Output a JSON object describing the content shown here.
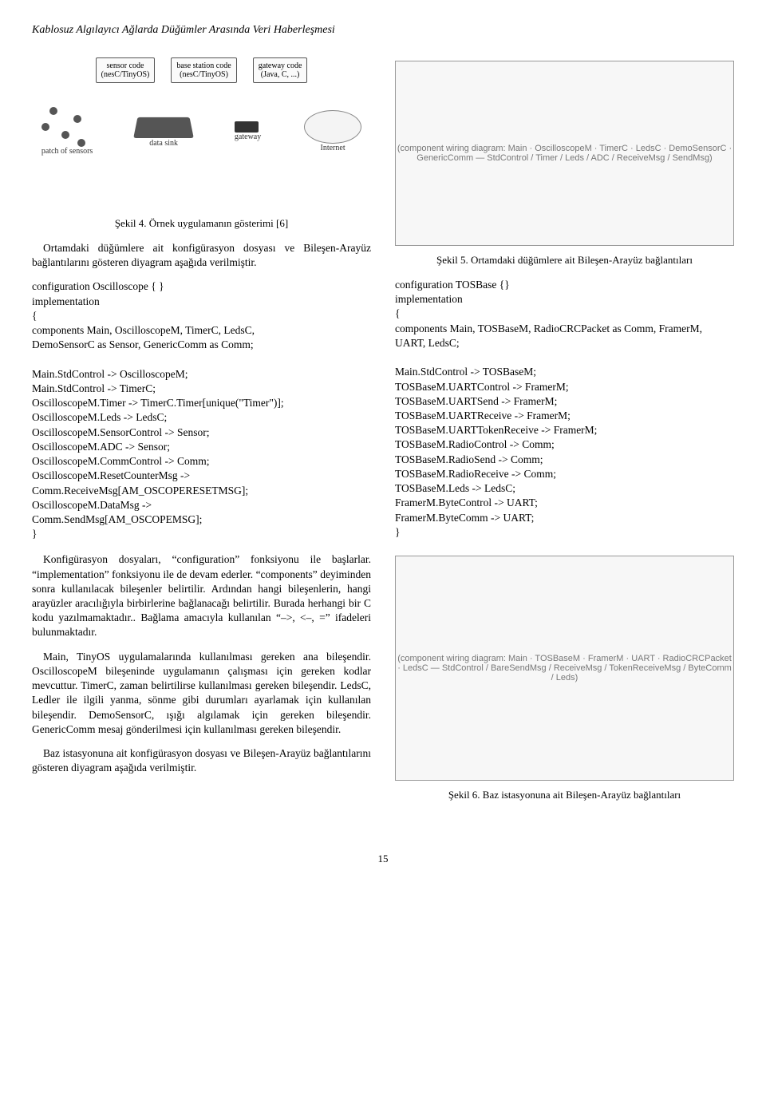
{
  "header": "Kablosuz Algılayıcı Ağlarda Düğümler Arasında Veri Haberleşmesi",
  "page_number": "15",
  "fig4": {
    "caption": "Şekil 4. Örnek uygulamanın gösterimi [6]",
    "box1": "sensor code\n(nesC/TinyOS)",
    "box2": "base station code\n(nesC/TinyOS)",
    "box3": "gateway code\n(Java, C, ...)",
    "lbl1": "patch of sensors",
    "lbl2": "data sink",
    "lbl3": "gateway",
    "lbl4": "Internet"
  },
  "fig5": {
    "caption": "Şekil 5. Ortamdaki düğümlere ait Bileşen-Arayüz bağlantıları",
    "placeholder": "(component wiring diagram: Main · OscilloscopeM · TimerC · LedsC · DemoSensorC · GenericComm — StdControl / Timer / Leds / ADC / ReceiveMsg / SendMsg)"
  },
  "fig6": {
    "caption": "Şekil 6. Baz istasyonuna ait Bileşen-Arayüz bağlantıları",
    "placeholder": "(component wiring diagram: Main · TOSBaseM · FramerM · UART · RadioCRCPacket · LedsC — StdControl / BareSendMsg / ReceiveMsg / TokenReceiveMsg / ByteComm / Leds)"
  },
  "left": {
    "para1": "Ortamdaki düğümlere ait konfigürasyon dosyası ve Bileşen-Arayüz bağlantılarını gösteren diyagram aşağıda verilmiştir.",
    "code1": "configuration Oscilloscope { }\nimplementation\n{\ncomponents Main, OscilloscopeM, TimerC, LedsC,\nDemoSensorC as Sensor, GenericComm as Comm;\n\nMain.StdControl -> OscilloscopeM;\nMain.StdControl -> TimerC;\nOscilloscopeM.Timer -> TimerC.Timer[unique(\"Timer\")];\nOscilloscopeM.Leds -> LedsC;\nOscilloscopeM.SensorControl -> Sensor;\nOscilloscopeM.ADC -> Sensor;\nOscilloscopeM.CommControl -> Comm;\nOscilloscopeM.ResetCounterMsg ->\nComm.ReceiveMsg[AM_OSCOPERESETMSG];\nOscilloscopeM.DataMsg ->\nComm.SendMsg[AM_OSCOPEMSG];\n}",
    "para2": "Konfigürasyon dosyaları, “configuration” fonksiyonu ile başlarlar. “implementation” fonksiyonu ile de devam ederler. “components” deyiminden sonra kullanılacak bileşenler belirtilir. Ardından hangi bileşenlerin, hangi arayüzler aracılığıyla birbirlerine bağlanacağı belirtilir. Burada herhangi bir C kodu yazılmamaktadır.. Bağlama amacıyla kullanılan “–>, <–, =” ifadeleri bulunmaktadır.",
    "para3": "Main, TinyOS uygulamalarında kullanılması gereken ana bileşendir. OscilloscopeM bileşeninde uygulamanın çalışması için gereken kodlar mevcuttur. TimerC, zaman belirtilirse kullanılması gereken bileşendir. LedsC, Ledler ile ilgili yanma, sönme gibi durumları ayarlamak için kullanılan bileşendir. DemoSensorC, ışığı algılamak için gereken bileşendir. GenericComm mesaj gönderilmesi için kullanılması gereken bileşendir.",
    "para4": "Baz istasyonuna ait konfigürasyon dosyası ve Bileşen-Arayüz bağlantılarını gösteren diyagram aşağıda verilmiştir."
  },
  "right": {
    "code1": "configuration TOSBase {}\nimplementation\n{\ncomponents Main, TOSBaseM, RadioCRCPacket as Comm, FramerM, UART, LedsC;\n\nMain.StdControl -> TOSBaseM;\nTOSBaseM.UARTControl -> FramerM;\nTOSBaseM.UARTSend -> FramerM;\nTOSBaseM.UARTReceive -> FramerM;\nTOSBaseM.UARTTokenReceive -> FramerM;\nTOSBaseM.RadioControl -> Comm;\nTOSBaseM.RadioSend -> Comm;\nTOSBaseM.RadioReceive -> Comm;\nTOSBaseM.Leds -> LedsC;\nFramerM.ByteControl -> UART;\nFramerM.ByteComm -> UART;\n}"
  }
}
